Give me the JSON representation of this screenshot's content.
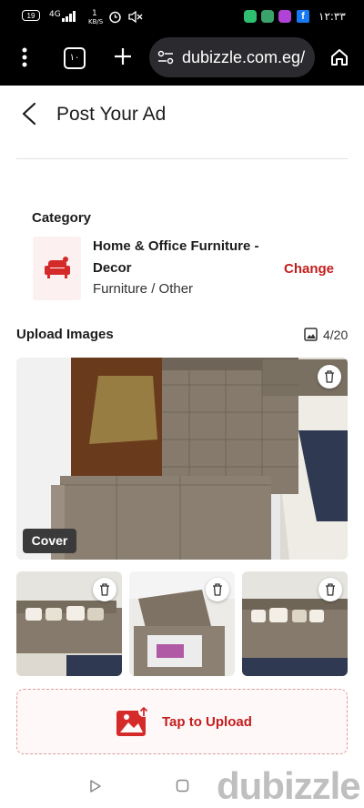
{
  "status_bar": {
    "battery": "19",
    "network": "4G",
    "speed": "1",
    "speed_unit": "KB/S",
    "time": "١٢:٣٣"
  },
  "browser": {
    "tab_count": "١٠",
    "url": "dubizzle.com.eg/"
  },
  "header": {
    "title": "Post Your Ad"
  },
  "category": {
    "label": "Category",
    "name": "Home & Office Furniture - Decor",
    "subcategory": "Furniture / Other",
    "change_label": "Change"
  },
  "upload": {
    "title": "Upload Images",
    "count": "4/20",
    "cover_label": "Cover",
    "tap_label": "Tap to Upload"
  },
  "watermark": "dubizzle",
  "colors": {
    "accent": "#c51c1c",
    "browser_bg": "#000000",
    "sofa": "#857a6c"
  }
}
